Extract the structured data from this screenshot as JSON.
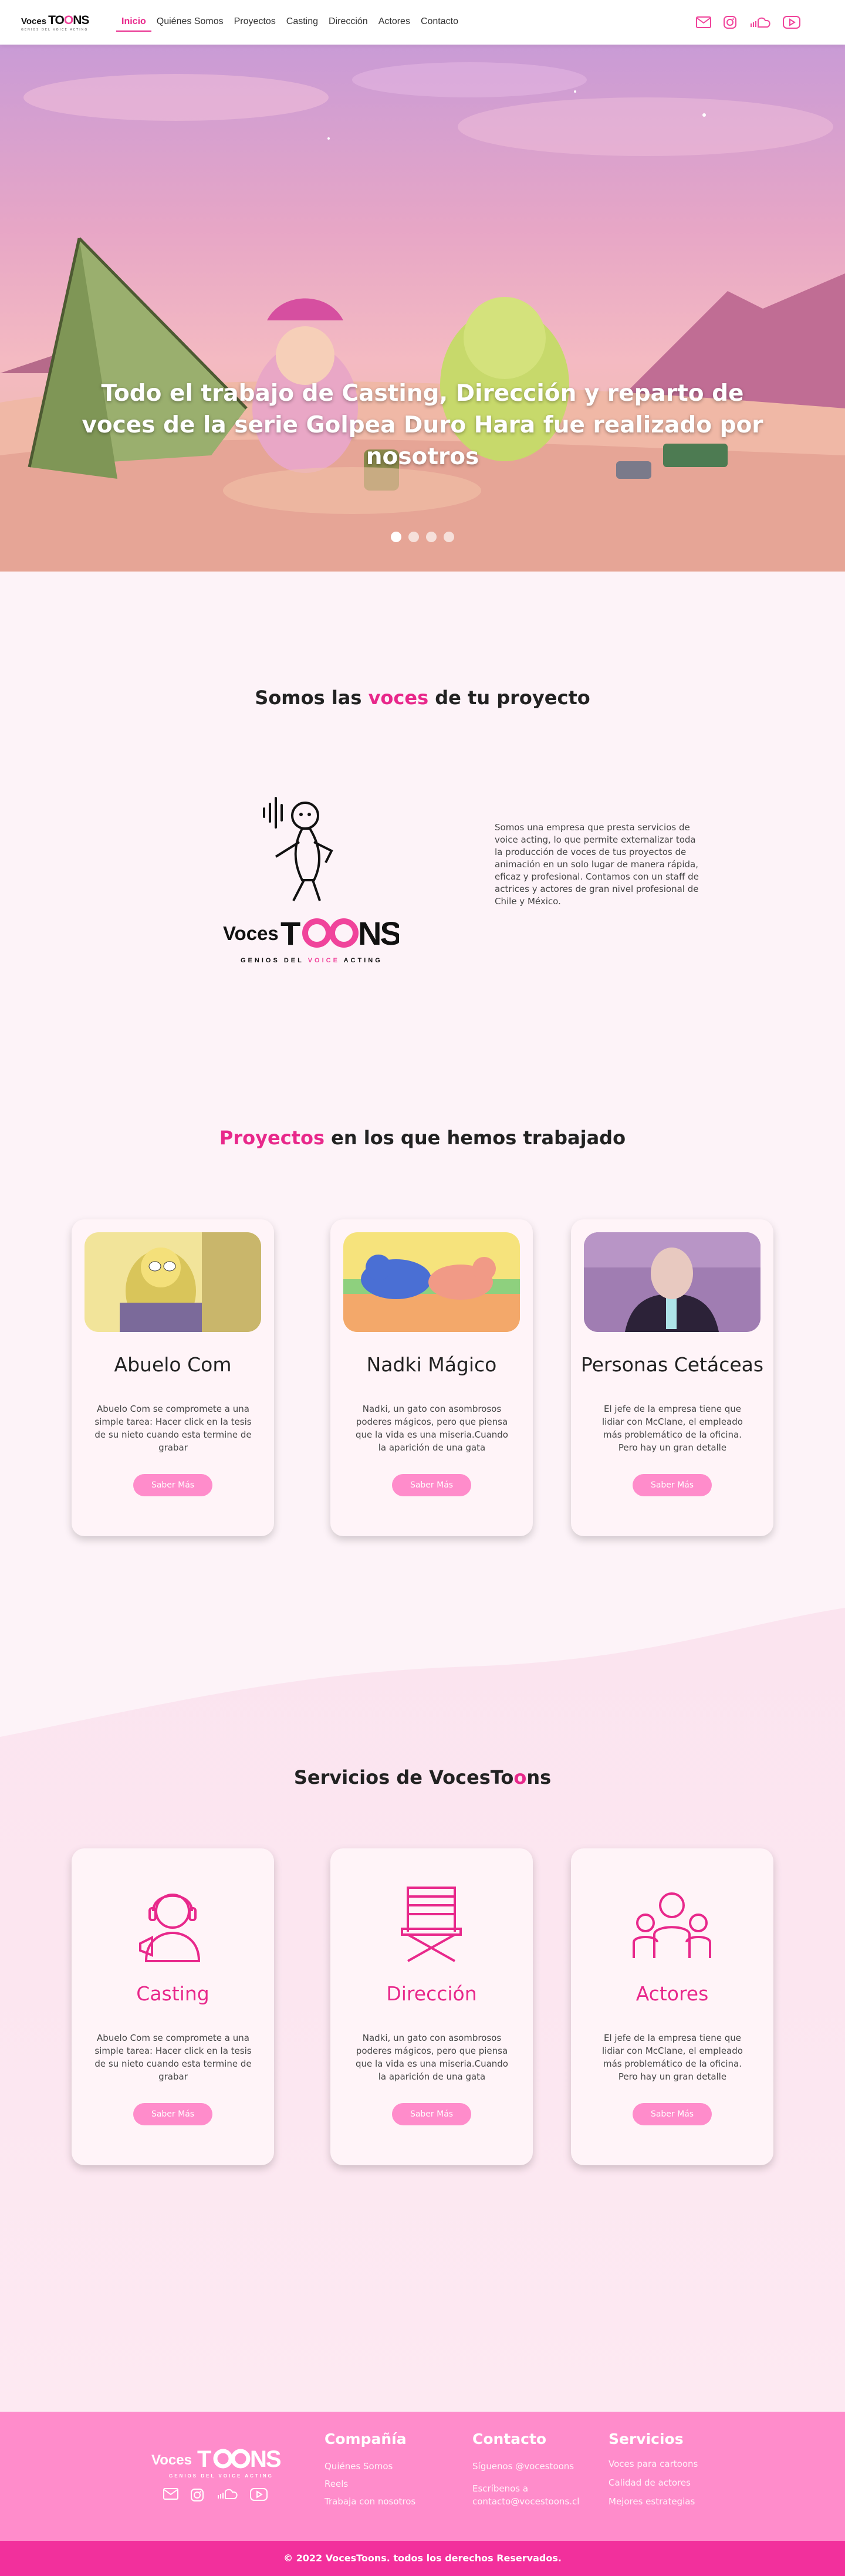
{
  "brand": {
    "logo_voces": "Voces",
    "logo_toons": "TOONS",
    "tagline": "GENIOS DEL VOICE ACTING"
  },
  "nav": {
    "items": [
      {
        "label": "Inicio",
        "active": true
      },
      {
        "label": "Quiénes Somos"
      },
      {
        "label": "Proyectos"
      },
      {
        "label": "Casting"
      },
      {
        "label": "Dirección"
      },
      {
        "label": "Actores"
      },
      {
        "label": "Contacto"
      }
    ],
    "icons": [
      "mail-icon",
      "instagram-icon",
      "soundcloud-icon",
      "youtube-icon"
    ]
  },
  "hero": {
    "title": "Todo el trabajo de Casting, Dirección y reparto de voces de la serie Golpea Duro Hara fue realizado por nosotros",
    "slides": 4,
    "active_slide": 0
  },
  "about": {
    "heading_pre": "Somos las ",
    "heading_highlight": "voces",
    "heading_post": " de tu proyecto",
    "text": "Somos una empresa que presta servicios de voice acting, lo que permite externalizar toda la producción de voces de tus proyectos de animación en un solo lugar de manera rápida, eficaz y profesional. Contamos con un staff de actrices y actores de gran nivel profesional de Chile y México."
  },
  "projects": {
    "heading_highlight": "Proyectos",
    "heading_post": " en los que hemos trabajado",
    "items": [
      {
        "title": "Abuelo Com",
        "desc": "Abuelo Com se compromete a una simple tarea: Hacer click en la tesis de su nieto cuando esta termine de grabar",
        "button": "Saber Más"
      },
      {
        "title": "Nadki Mágico",
        "desc": "Nadki, un gato con asombrosos poderes mágicos, pero que piensa que la vida es una miseria.Cuando la aparición de una gata",
        "button": "Saber Más"
      },
      {
        "title": "Personas Cetáceas",
        "desc": "El jefe de la empresa tiene que lidiar con McClane, el empleado más problemático de la oficina. Pero hay un gran detalle",
        "button": "Saber Más"
      }
    ]
  },
  "services": {
    "heading_pre": "Servicios de VocesTo",
    "heading_highlight": "o",
    "heading_post": "ns",
    "items": [
      {
        "title": "Casting",
        "icon": "headset-person-icon",
        "desc": "Abuelo Com se compromete a una simple tarea: Hacer click en la tesis de su nieto cuando esta termine de grabar",
        "button": "Saber Más"
      },
      {
        "title": "Dirección",
        "icon": "director-chair-icon",
        "desc": "Nadki, un gato con asombrosos poderes mágicos, pero que piensa que la vida es una miseria.Cuando la aparición de una gata",
        "button": "Saber Más"
      },
      {
        "title": "Actores",
        "icon": "group-people-icon",
        "desc": "El jefe de la empresa tiene que lidiar con McClane, el empleado más problemático de la oficina. Pero hay un gran detalle",
        "button": "Saber Más"
      }
    ]
  },
  "footer": {
    "columns": [
      {
        "title": "Compañía",
        "links": [
          "Quiénes Somos",
          "Reels",
          "Trabaja con nosotros"
        ]
      },
      {
        "title": "Contacto",
        "links": [
          "Síguenos @vocestoons",
          "Escríbenos a contacto@vocestoons.cl"
        ]
      },
      {
        "title": "Servicios",
        "links": [
          "Voces para cartoons",
          "Calidad de actores",
          "Mejores estrategias"
        ]
      }
    ],
    "copyright": "© 2022 VocesToons.  todos los derechos Reservados."
  },
  "colors": {
    "accent": "#e8288b",
    "button": "#ff8ccb",
    "footer": "#ff8ccb",
    "footer_bar": "#f2309c"
  }
}
